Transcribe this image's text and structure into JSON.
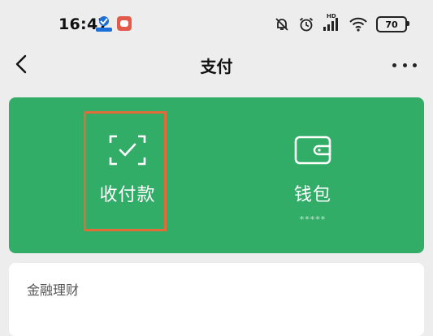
{
  "status_bar": {
    "time": "16:47",
    "hd_label": "HD",
    "battery": "70"
  },
  "nav": {
    "title": "支付"
  },
  "pay_card": {
    "accent": "#32ad67",
    "collect_label": "收付款",
    "wallet_label": "钱包",
    "wallet_balance_mask": "*****"
  },
  "finance": {
    "title": "金融理财"
  }
}
